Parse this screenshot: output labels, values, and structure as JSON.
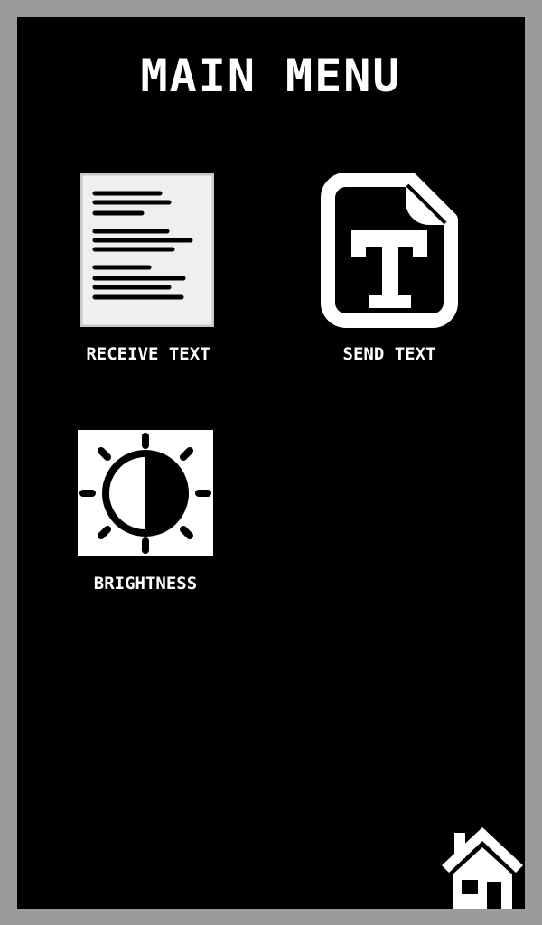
{
  "screen": {
    "title": "MAIN MENU"
  },
  "menu": {
    "items": [
      {
        "label": "RECEIVE TEXT",
        "icon": "document-lines-icon"
      },
      {
        "label": "SEND TEXT",
        "icon": "text-file-icon"
      },
      {
        "label": "BRIGHTNESS",
        "icon": "brightness-icon"
      }
    ]
  },
  "home": {
    "icon": "home-icon"
  },
  "colors": {
    "bezel": "#9b9b9b",
    "screen_background": "#000000",
    "foreground": "#ffffff",
    "document_paper": "#efefef"
  }
}
